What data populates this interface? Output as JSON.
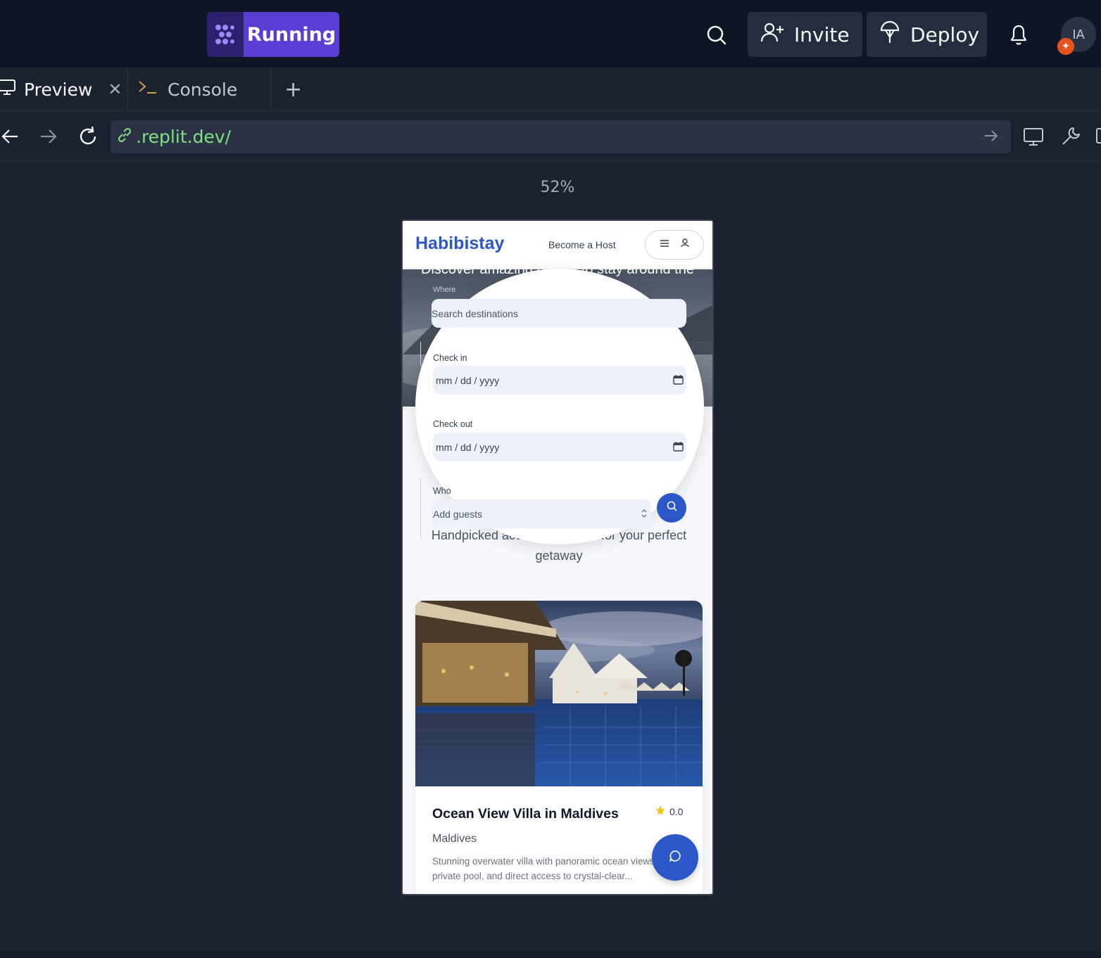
{
  "topbar": {
    "running_label": "Running",
    "invite_label": "Invite",
    "deploy_label": "Deploy",
    "avatar_initials": "IA"
  },
  "tabs": [
    {
      "label": "Preview"
    },
    {
      "label": "Console"
    }
  ],
  "browser": {
    "url": ".replit.dev/",
    "zoom": "52%"
  },
  "app": {
    "brand": "Habibistay",
    "become_host": "Become a Host",
    "hero_text": "Discover amazing places to stay around the",
    "search": {
      "where_label": "Where",
      "where_placeholder": "Search destinations",
      "checkin_label": "Check in",
      "checkin_value": "mm / dd / yyyy",
      "checkout_label": "Check out",
      "checkout_value": "mm / dd / yyyy",
      "who_label": "Who",
      "who_value": "Add guests"
    },
    "subtitle_line1": "Handpicked accommodations for your perfect",
    "subtitle_line2": "getaway",
    "listing": {
      "title": "Ocean View Villa in Maldives",
      "rating": "0.0",
      "location": "Maldives",
      "description": "Stunning overwater villa with panoramic ocean views, private pool, and direct access to crystal-clear..."
    }
  },
  "colors": {
    "accent": "#5a3ed4",
    "brand_blue": "#2c57c8",
    "url_green": "#7ee27e"
  }
}
